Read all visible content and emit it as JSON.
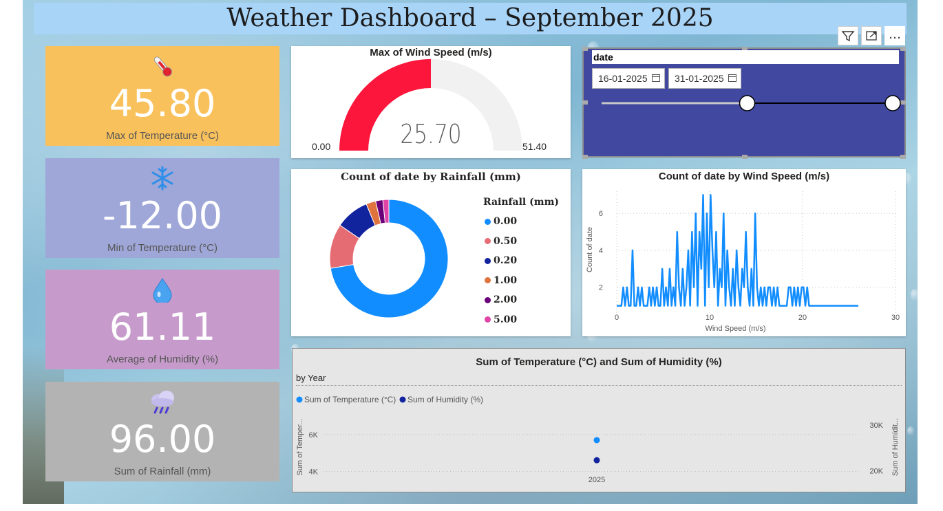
{
  "dashboard": {
    "title": "Weather Dashboard – September 2025"
  },
  "colors": {
    "kpi_temp_max": "#f9c15c",
    "kpi_temp_min": "#9fa7d8",
    "kpi_humidity": "#c69bcb",
    "kpi_rainfall": "#b3b3b3",
    "gauge_fill": "#fd163b",
    "gauge_track": "#f1f1f1",
    "series_blue": "#118dff",
    "series_navy": "#12239e",
    "slicer_bg": "#4148a0"
  },
  "kpis": [
    {
      "icon": "thermometer-icon",
      "value": "45.80",
      "label": "Max of Temperature (°C)"
    },
    {
      "icon": "snowflake-icon",
      "value": "-12.00",
      "label": "Min of Temperature (°C)"
    },
    {
      "icon": "droplet-icon",
      "value": "61.11",
      "label": "Average of Humidity (%)"
    },
    {
      "icon": "rain-cloud-icon",
      "value": "96.00",
      "label": "Sum of Rainfall (mm)"
    }
  ],
  "gauge": {
    "title": "Max of Wind Speed (m/s)",
    "value": 25.7,
    "value_label": "25.70",
    "min": 0,
    "min_label": "0.00",
    "max": 51.4,
    "max_label": "51.40"
  },
  "slicer": {
    "title": "date",
    "start_date": "16-01-2025",
    "end_date": "31-01-2025",
    "range_start_fraction": 0.5,
    "range_end_fraction": 1.0
  },
  "visual_header": {
    "filter_icon": "filter-icon",
    "focus_icon": "focus-mode-icon",
    "more_icon": "more-options-icon",
    "more_label": "…"
  },
  "chart_data": [
    {
      "type": "pie",
      "variant": "donut",
      "title": "Count of date by Rainfall (mm)",
      "legend_title": "Rainfall (mm)",
      "legend_placement": "right",
      "slices": [
        {
          "label": "0.00",
          "value": 220,
          "color": "#118dff"
        },
        {
          "label": "0.50",
          "value": 37,
          "color": "#e66c73"
        },
        {
          "label": "0.20",
          "value": 28,
          "color": "#12239e"
        },
        {
          "label": "1.00",
          "value": 8,
          "color": "#e0733d"
        },
        {
          "label": "2.00",
          "value": 6,
          "color": "#6b007b"
        },
        {
          "label": "5.00",
          "value": 5,
          "color": "#e044a7"
        }
      ]
    },
    {
      "type": "line",
      "title": "Count of date by Wind Speed (m/s)",
      "xlabel": "Wind Speed (m/s)",
      "ylabel": "Count of date",
      "xlim": [
        0,
        30
      ],
      "ylim": [
        0.5,
        7.2
      ],
      "xticks": [
        0,
        10,
        20,
        30
      ],
      "yticks": [
        2,
        4,
        6
      ],
      "grid": true,
      "color": "#118dff",
      "x": [
        0,
        0.5,
        0.7,
        0.9,
        1.1,
        1.3,
        1.5,
        1.7,
        1.9,
        2.1,
        2.3,
        2.5,
        2.7,
        2.9,
        3.1,
        3.3,
        3.5,
        3.7,
        3.9,
        4.1,
        4.3,
        4.5,
        4.7,
        4.9,
        5.1,
        5.3,
        5.5,
        5.7,
        5.9,
        6.1,
        6.3,
        6.5,
        6.7,
        6.9,
        7.1,
        7.3,
        7.5,
        7.7,
        7.9,
        8.1,
        8.3,
        8.5,
        8.7,
        8.9,
        9.1,
        9.3,
        9.5,
        9.7,
        9.9,
        10.1,
        10.3,
        10.5,
        10.7,
        10.9,
        11.1,
        11.3,
        11.5,
        11.7,
        11.9,
        12.1,
        12.3,
        12.5,
        12.7,
        12.9,
        13.1,
        13.3,
        13.5,
        13.7,
        13.9,
        14.1,
        14.3,
        14.5,
        14.7,
        14.9,
        15.1,
        15.3,
        15.5,
        15.7,
        15.9,
        16.1,
        16.3,
        16.5,
        16.7,
        16.9,
        17.1,
        17.3,
        17.5,
        17.7,
        17.9,
        18.1,
        18.3,
        18.5,
        18.7,
        18.9,
        19.1,
        19.3,
        19.5,
        19.7,
        19.9,
        20.1,
        20.3,
        20.5,
        20.7,
        21,
        22,
        23,
        24,
        25,
        26
      ],
      "y": [
        1,
        1,
        2,
        1,
        2,
        1,
        1,
        4,
        1,
        1,
        2,
        1,
        2,
        1,
        1,
        1,
        2,
        1,
        2,
        1,
        2,
        1,
        1,
        3,
        1,
        2,
        1,
        3,
        1,
        2,
        1,
        5,
        2,
        1,
        3,
        1,
        2,
        4,
        1,
        5,
        2,
        6,
        1,
        5,
        3,
        7,
        1,
        6,
        2,
        7,
        4,
        2,
        5,
        1,
        3,
        2,
        6,
        1,
        4,
        2,
        1,
        3,
        1,
        4,
        2,
        1,
        3,
        2,
        5,
        2,
        1,
        3,
        1,
        6,
        2,
        1,
        2,
        1,
        2,
        1,
        2,
        2,
        1,
        2,
        1,
        2,
        1,
        1,
        1,
        1,
        1,
        2,
        2,
        1,
        2,
        1,
        2,
        1,
        2,
        2,
        1,
        2,
        1,
        1,
        1,
        1,
        1,
        1,
        1
      ]
    },
    {
      "type": "scatter",
      "title": "Sum of Temperature (°C) and Sum of Humidity (%)",
      "subtitle": "by Year",
      "categories": [
        "2025"
      ],
      "legend_placement": "top-left",
      "y_left_label": "Sum of Temper...",
      "y_right_label": "Sum of Humidit...",
      "y_left_ticks": [
        "6K",
        "4K"
      ],
      "y_left_tick_values": [
        6000,
        4000
      ],
      "y_left_lim": [
        3800,
        7000
      ],
      "y_right_ticks": [
        "30K",
        "20K"
      ],
      "y_right_tick_values": [
        30000,
        20000
      ],
      "y_right_lim": [
        19000,
        32000
      ],
      "series": [
        {
          "name": "Sum of Temperature (°C)",
          "axis": "left",
          "values": [
            5700
          ],
          "color": "#118dff"
        },
        {
          "name": "Sum of Humidity (%)",
          "axis": "right",
          "values": [
            22300
          ],
          "color": "#12239e"
        }
      ]
    }
  ]
}
